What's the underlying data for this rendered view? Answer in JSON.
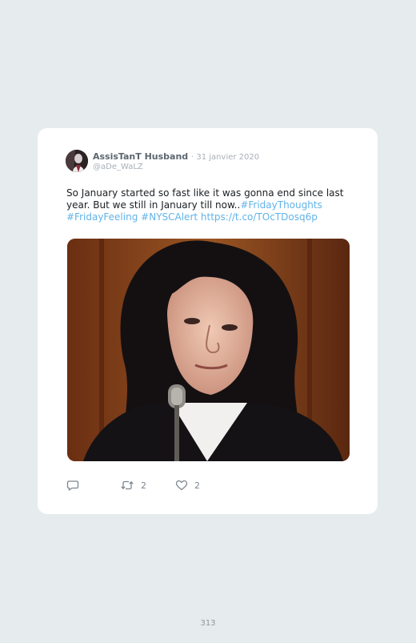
{
  "tweet": {
    "display_name": "AssisTanT Husband",
    "separator": "·",
    "date": "31 janvier 2020",
    "handle": "@aDe_WaLZ",
    "text_plain": "So January started so fast like it was gonna end since last year. But we still in January till now..",
    "hashtag_1": "#FridayThoughts",
    "hashtag_2": "#FridayFeeling",
    "hashtag_3": "#NYSCAlert",
    "url": "https://t.co/TOcTDosq6p",
    "retweet_count": "2",
    "like_count": "2"
  },
  "icons": {
    "reply": "reply-icon",
    "retweet": "retweet-icon",
    "like": "heart-icon"
  },
  "colors": {
    "background": "#e6ebee",
    "card": "#ffffff",
    "link": "#61b3e8",
    "muted": "#a7b0b8"
  },
  "page": {
    "number": "313"
  }
}
